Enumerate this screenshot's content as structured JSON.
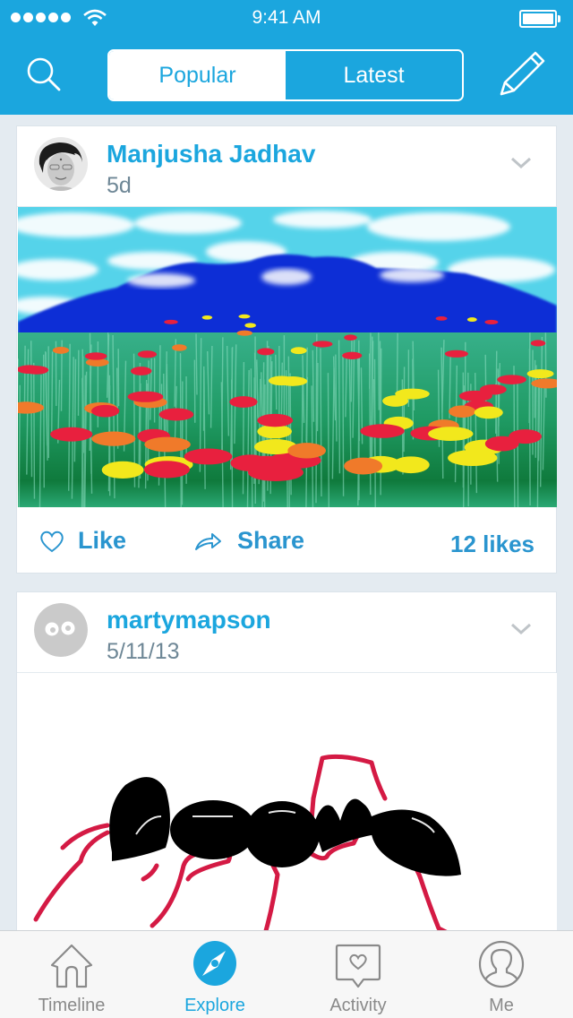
{
  "status_bar": {
    "time": "9:41 AM",
    "signal_bars": 5,
    "battery_percent": 100
  },
  "nav": {
    "search_icon": "search-icon",
    "compose_icon": "pencil-icon",
    "segments": [
      {
        "label": "Popular",
        "selected": true
      },
      {
        "label": "Latest",
        "selected": false
      }
    ]
  },
  "posts": [
    {
      "username": "Manjusha Jadhav",
      "timestamp": "5d",
      "avatar": "user-photo",
      "artwork": "painting of flower meadow with blue mountains and cloudy sky",
      "actions": {
        "like_label": "Like",
        "share_label": "Share",
        "likes_count": "12 likes"
      }
    },
    {
      "username": "martymapson",
      "timestamp": "5/11/13",
      "avatar": "default-avatar-eyes",
      "artwork": "drawing of a black ant with red legs"
    }
  ],
  "tabbar": {
    "items": [
      {
        "label": "Timeline",
        "icon": "house-icon",
        "active": false
      },
      {
        "label": "Explore",
        "icon": "compass-icon",
        "active": true
      },
      {
        "label": "Activity",
        "icon": "heart-bubble-icon",
        "active": false
      },
      {
        "label": "Me",
        "icon": "person-icon",
        "active": false
      }
    ]
  },
  "colors": {
    "brand": "#1ba6de",
    "background": "#e4ebf1",
    "link": "#2a95cf",
    "muted": "#6e8796",
    "tab_inactive": "#8a8a8a"
  }
}
